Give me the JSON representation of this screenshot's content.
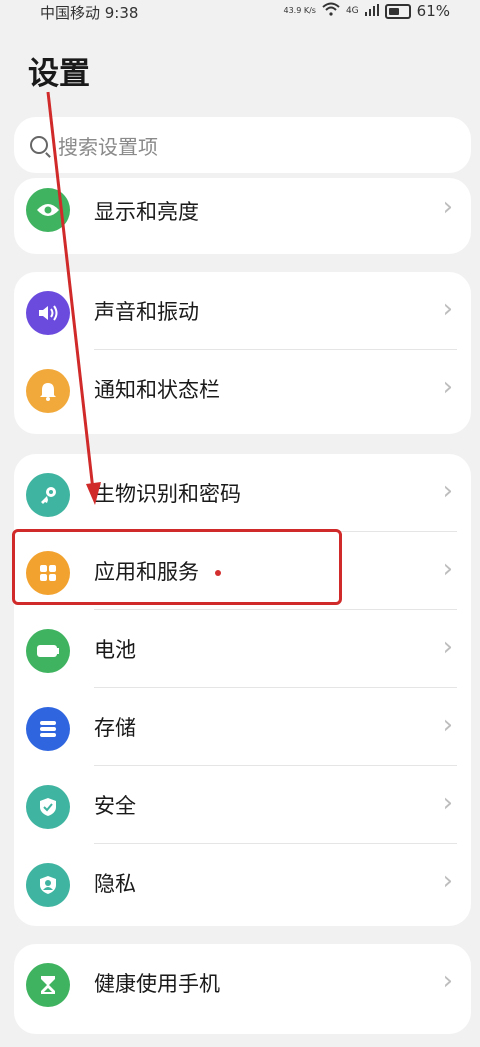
{
  "status": {
    "carrier_time": "中国移动 9:38",
    "speed": "43.9 K/s",
    "network": "4G",
    "battery": "61%"
  },
  "page": {
    "title": "设置"
  },
  "search": {
    "placeholder": "搜索设置项"
  },
  "items": {
    "display": {
      "label": "显示和亮度",
      "color": "#3fb35f"
    },
    "sound": {
      "label": "声音和振动",
      "color": "#6a4bde"
    },
    "notify": {
      "label": "通知和状态栏",
      "color": "#f2a93b"
    },
    "biometric": {
      "label": "生物识别和密码",
      "color": "#3fb4a0"
    },
    "apps": {
      "label": "应用和服务",
      "color": "#f2a22f"
    },
    "battery": {
      "label": "电池",
      "color": "#3fb35f"
    },
    "storage": {
      "label": "存储",
      "color": "#2f66e0"
    },
    "security": {
      "label": "安全",
      "color": "#3fb4a0"
    },
    "privacy": {
      "label": "隐私",
      "color": "#3fb4a0"
    },
    "health": {
      "label": "健康使用手机",
      "color": "#3fb35f"
    }
  }
}
